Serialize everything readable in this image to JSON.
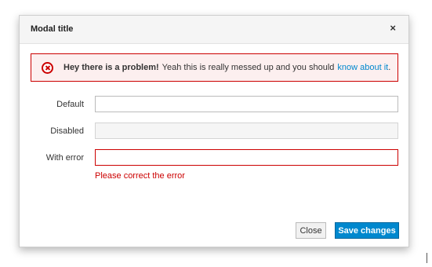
{
  "modal": {
    "title": "Modal title",
    "close_icon": "×"
  },
  "alert": {
    "icon": "error-circle-icon",
    "strong": "Hey there is a problem!",
    "text": "Yeah this is really messed up and you should",
    "link": "know about it",
    "end": "."
  },
  "form": {
    "default_label": "Default",
    "default_value": "",
    "disabled_label": "Disabled",
    "disabled_value": "",
    "error_label": "With error",
    "error_value": "",
    "error_message": "Please correct the error"
  },
  "footer": {
    "close_label": "Close",
    "save_label": "Save changes"
  },
  "colors": {
    "accent": "#0088ce",
    "error": "#cc0000"
  }
}
